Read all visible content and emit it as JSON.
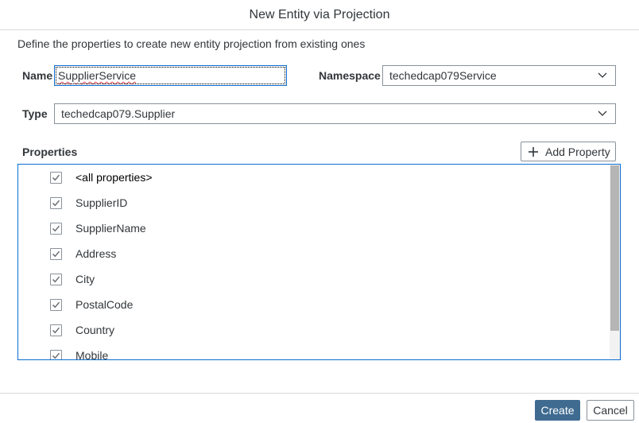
{
  "dialog": {
    "title": "New Entity via Projection",
    "description": "Define the properties to create new entity projection from existing ones"
  },
  "form": {
    "name": {
      "label": "Name",
      "value": "SupplierService"
    },
    "namespace": {
      "label": "Namespace",
      "value": "techedcap079Service"
    },
    "type": {
      "label": "Type",
      "value": "techedcap079.Supplier"
    }
  },
  "properties": {
    "label": "Properties",
    "add_button_label": "Add Property",
    "items": [
      {
        "label": "<all properties>",
        "checked": true
      },
      {
        "label": "SupplierID",
        "checked": true
      },
      {
        "label": "SupplierName",
        "checked": true
      },
      {
        "label": "Address",
        "checked": true
      },
      {
        "label": "City",
        "checked": true
      },
      {
        "label": "PostalCode",
        "checked": true
      },
      {
        "label": "Country",
        "checked": true
      },
      {
        "label": "Mobile",
        "checked": true
      }
    ]
  },
  "footer": {
    "create_label": "Create",
    "cancel_label": "Cancel"
  },
  "colors": {
    "primary_button": "#3f6b91",
    "focus_border": "#0a6ed1",
    "text": "#32363a"
  },
  "icons": {
    "dropdown": "chevron-down-icon",
    "add": "plus-icon",
    "checkbox": "checkmark-icon"
  }
}
